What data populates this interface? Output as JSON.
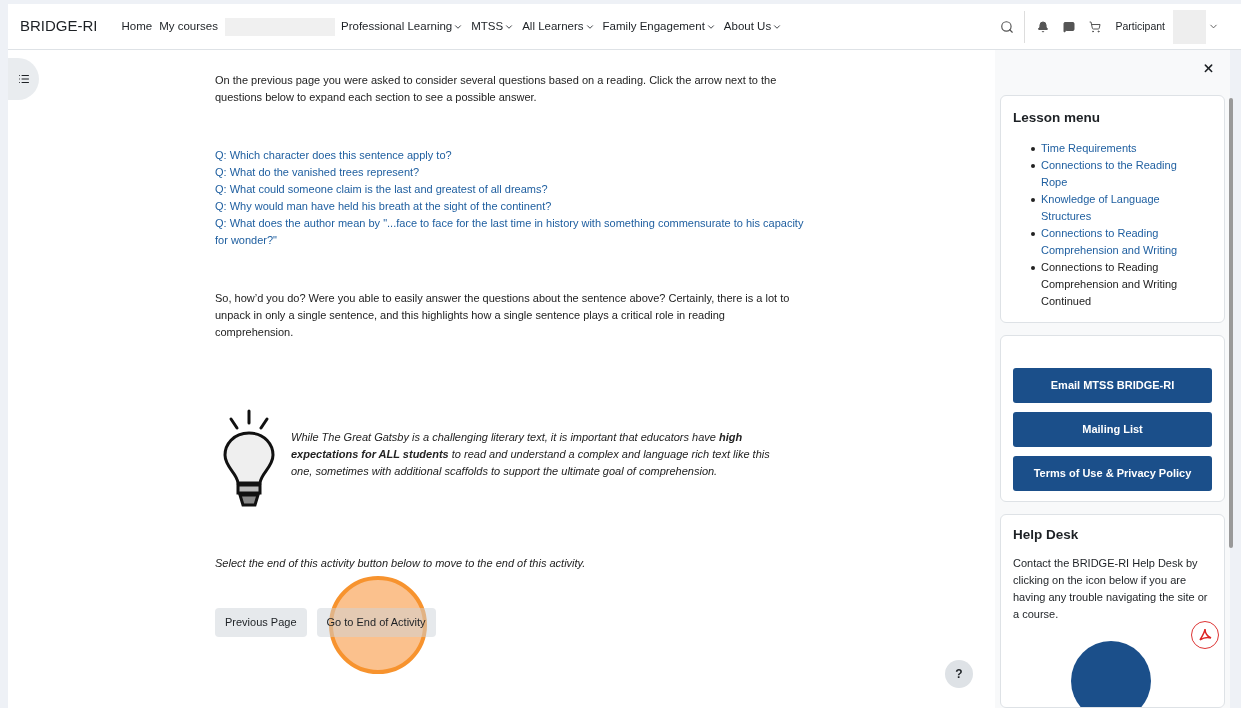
{
  "navbar": {
    "brand": "BRIDGE-RI",
    "links": [
      {
        "label": "Home",
        "dropdown": false
      },
      {
        "label": "My courses",
        "dropdown": false
      }
    ],
    "menus": [
      {
        "label": "Professional Learning",
        "dropdown": true
      },
      {
        "label": "MTSS",
        "dropdown": true
      },
      {
        "label": "All Learners",
        "dropdown": true
      },
      {
        "label": "Family Engagement",
        "dropdown": true
      },
      {
        "label": "About Us",
        "dropdown": true
      }
    ],
    "user": "Participant"
  },
  "content": {
    "intro": "On the previous page you were asked to consider several questions based on a reading. Click the arrow next to the questions below to expand each section to see a possible answer.",
    "questions": [
      "Q: Which character does this sentence apply to?",
      "Q: What do the vanished trees represent?",
      "Q: What could someone claim is the last and greatest of all dreams?",
      "Q: Why would man have held his breath at the sight of the continent?",
      "Q: What does the author mean by \"...face to face for the last time in history with something commensurate to his capacity for wonder?\""
    ],
    "summary": "So, how’d you do? Were you able to easily answer the questions about the sentence above? Certainly, there is a lot to unpack in only a single sentence, and this highlights how a single sentence plays a critical role in reading comprehension.",
    "callout": "While The Great Gatsby is a challenging literary text, it is important that educators have **high expectations for ALL students** to read and understand a complex and language rich text like this one, sometimes with additional scaffolds to support the ultimate goal of comprehension.",
    "instruction": "Select the end of this activity button below to move to the end of this activity.",
    "buttons": [
      "Previous Page",
      "Go to End of Activity"
    ],
    "help_button": "?"
  },
  "drawer": {
    "lesson_menu": {
      "title": "Lesson menu",
      "items": [
        {
          "label": "Time Requirements",
          "selected": false
        },
        {
          "label": "Connections to the Reading Rope",
          "selected": false
        },
        {
          "label": "Knowledge of Language Structures",
          "selected": false
        },
        {
          "label": "Connections to Reading Comprehension and Writing",
          "selected": false
        },
        {
          "label": "Connections to Reading Comprehension and Writing Continued",
          "selected": true
        }
      ]
    },
    "buttons": [
      "Email MTSS BRIDGE-RI",
      "Mailing List",
      "Terms of Use & Privacy Policy"
    ],
    "help_desk": {
      "title": "Help Desk",
      "text": "Contact the BRIDGE-RI Help Desk by clicking on the icon below if you are having any trouble navigating the site or a course."
    }
  }
}
